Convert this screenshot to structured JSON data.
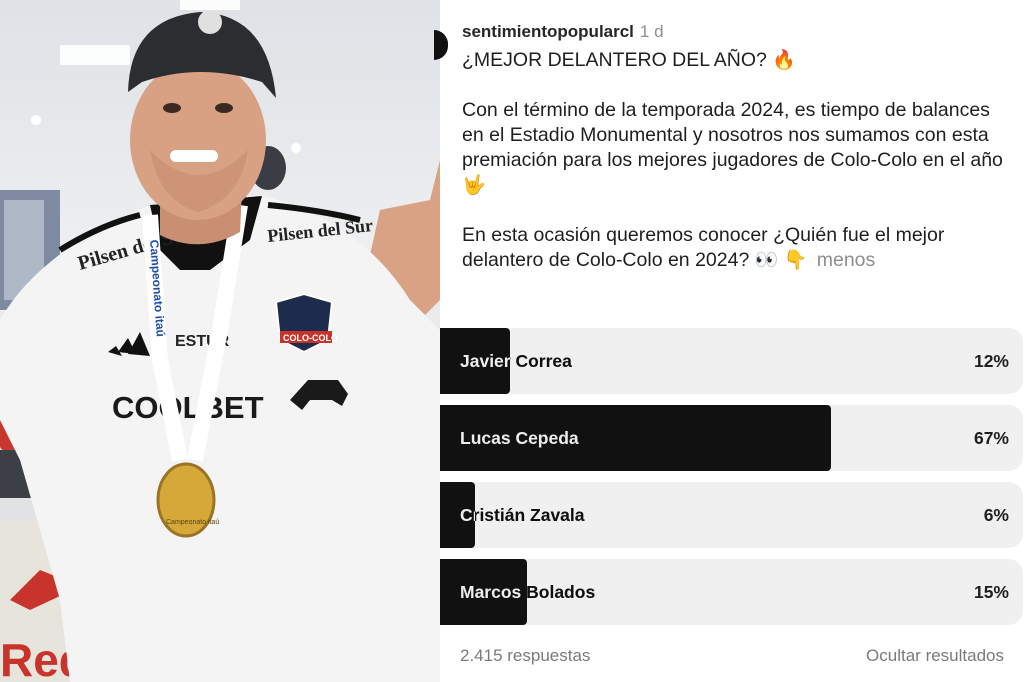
{
  "post": {
    "username": "sentimientopopularcl",
    "time": "1 d",
    "title": "¿MEJOR DELANTERO DEL AÑO?",
    "title_emoji": "🔥",
    "paragraph1": "Con el término de la temporada 2024, es tiempo de balances en el Estadio Monumental y nosotros nos sumamos con esta premiación para los mejores jugadores de Colo-Colo en el año",
    "paragraph1_emoji": "🤟",
    "paragraph2": "En esta ocasión queremos conocer ¿Quién fue el mejor delantero de Colo-Colo en 2024?",
    "paragraph2_emoji": "👀 👇",
    "less_label": "menos"
  },
  "photo": {
    "shirt_sponsor_1": "Pilsen del Sur",
    "shirt_sponsor_2": "COOLBET",
    "shirt_brand": "ESTUR",
    "crest_label": "COLO-COLO",
    "lanyard_text": "Campeonato itaú",
    "medal_text": "Campeonato itaú",
    "background_brand": "Red"
  },
  "poll": {
    "options": [
      {
        "name": "Javier Correa",
        "percent_label": "12%",
        "percent": 12
      },
      {
        "name": "Lucas Cepeda",
        "percent_label": "67%",
        "percent": 67
      },
      {
        "name": "Cristián Zavala",
        "percent_label": "6%",
        "percent": 6
      },
      {
        "name": "Marcos Bolados",
        "percent_label": "15%",
        "percent": 15
      }
    ],
    "responses_label": "2.415 respuestas",
    "hide_results_label": "Ocultar resultados"
  },
  "colors": {
    "bar_fill": "#111111",
    "bar_track": "#f0f0f0",
    "muted_text": "#8e8e8e",
    "shirt": "#f4f4f4",
    "cap": "#2b2d31"
  }
}
